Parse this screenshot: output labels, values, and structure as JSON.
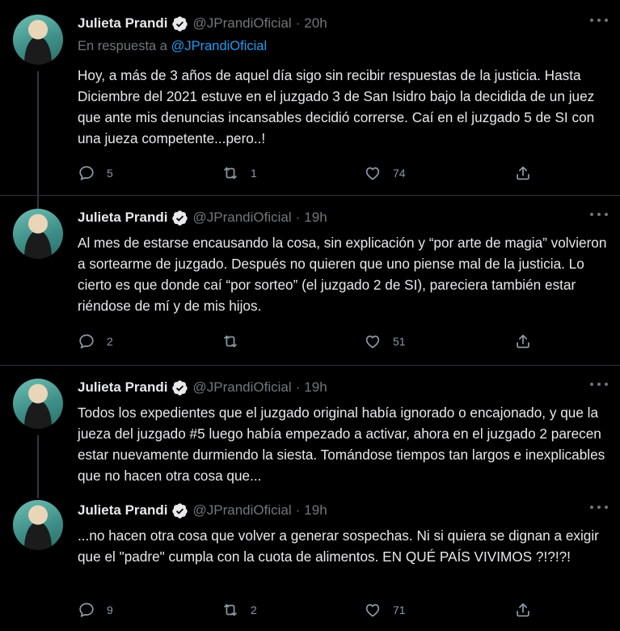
{
  "tweets": [
    {
      "name": "Julieta Prandi",
      "handle": "@JPrandiOficial",
      "time": "20h",
      "reply_prefix": "En respuesta a",
      "reply_mention": "@JPrandiOficial",
      "text": "Hoy, a más de 3 años de aquel día sigo sin recibir respuestas de la justicia. Hasta Diciembre del 2021 estuve en el juzgado 3 de San Isidro bajo la decidida de un juez que ante mis denuncias incansables decidió correrse. Caí en el juzgado 5 de SI con una jueza competente...pero..!",
      "replies": "5",
      "retweets": "1",
      "likes": "74"
    },
    {
      "name": "Julieta Prandi",
      "handle": "@JPrandiOficial",
      "time": "19h",
      "text": "Al mes de estarse encausando la cosa, sin explicación y “por arte de magia” volvieron a sortearme de juzgado. Después no quieren que uno piense mal de la justicia. Lo cierto es que donde caí “por sorteo” (el juzgado 2 de SI), pareciera también estar riéndose de mí y de mis hijos.",
      "replies": "2",
      "retweets": "",
      "likes": "51"
    },
    {
      "name": "Julieta Prandi",
      "handle": "@JPrandiOficial",
      "time": "19h",
      "text": "Todos los expedientes que el juzgado original había ignorado o encajonado, y que la jueza del juzgado #5 luego había empezado a activar, ahora en el juzgado 2 parecen estar nuevamente durmiendo la siesta. Tomándose tiempos tan largos e inexplicables que no hacen otra cosa que..."
    },
    {
      "name": "Julieta Prandi",
      "handle": "@JPrandiOficial",
      "time": "19h",
      "text": "...no hacen otra cosa que volver a generar sospechas. Ni si quiera se dignan a exigir que el \"padre\" cumpla con la cuota de alimentos. EN QUÉ PAÍS VIVIMOS ?!?!?!",
      "replies": "9",
      "retweets": "2",
      "likes": "71"
    }
  ],
  "icons": {
    "verified": "verified-badge-icon",
    "more": "more-icon",
    "reply": "reply-icon",
    "retweet": "retweet-icon",
    "like": "like-icon",
    "share": "share-icon"
  },
  "colors": {
    "background": "#000000",
    "text": "#e7e9ea",
    "muted": "#71767b",
    "link": "#1d9bf0"
  }
}
